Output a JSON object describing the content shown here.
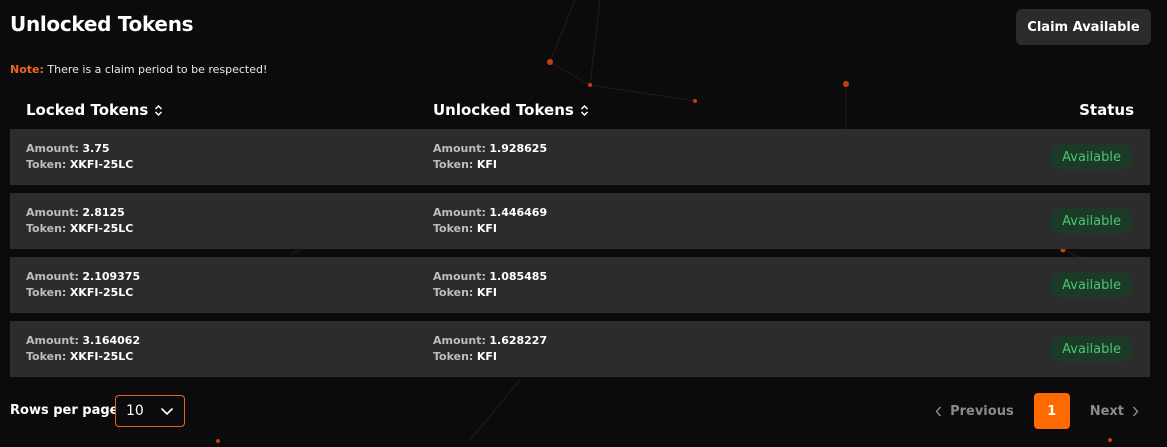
{
  "header": {
    "title": "Unlocked Tokens",
    "claim_button": "Claim Available"
  },
  "note": {
    "label": "Note:",
    "text": "There is a claim period to be respected!"
  },
  "table": {
    "columns": {
      "locked": "Locked Tokens",
      "unlocked": "Unlocked Tokens",
      "status": "Status"
    },
    "amount_label": "Amount:",
    "token_label": "Token:",
    "rows": [
      {
        "locked_amount": "3.75",
        "locked_token": "XKFI-25LC",
        "unlocked_amount": "1.928625",
        "unlocked_token": "KFI",
        "status": "Available"
      },
      {
        "locked_amount": "2.8125",
        "locked_token": "XKFI-25LC",
        "unlocked_amount": "1.446469",
        "unlocked_token": "KFI",
        "status": "Available"
      },
      {
        "locked_amount": "2.109375",
        "locked_token": "XKFI-25LC",
        "unlocked_amount": "1.085485",
        "unlocked_token": "KFI",
        "status": "Available"
      },
      {
        "locked_amount": "3.164062",
        "locked_token": "XKFI-25LC",
        "unlocked_amount": "1.628227",
        "unlocked_token": "KFI",
        "status": "Available"
      }
    ]
  },
  "footer": {
    "rows_per_page_label": "Rows per page",
    "rows_per_page_value": "10",
    "previous": "Previous",
    "current_page": "1",
    "next": "Next"
  },
  "colors": {
    "accent": "#ff6a00",
    "status_available": "#4cc76f",
    "row_bg": "#2c2c2c",
    "page_bg": "#0b0b0d"
  },
  "icons": {
    "sort": "sort-icon",
    "dropdown": "chevron-down-icon",
    "prev": "chevron-left-icon",
    "next": "chevron-right-icon"
  }
}
